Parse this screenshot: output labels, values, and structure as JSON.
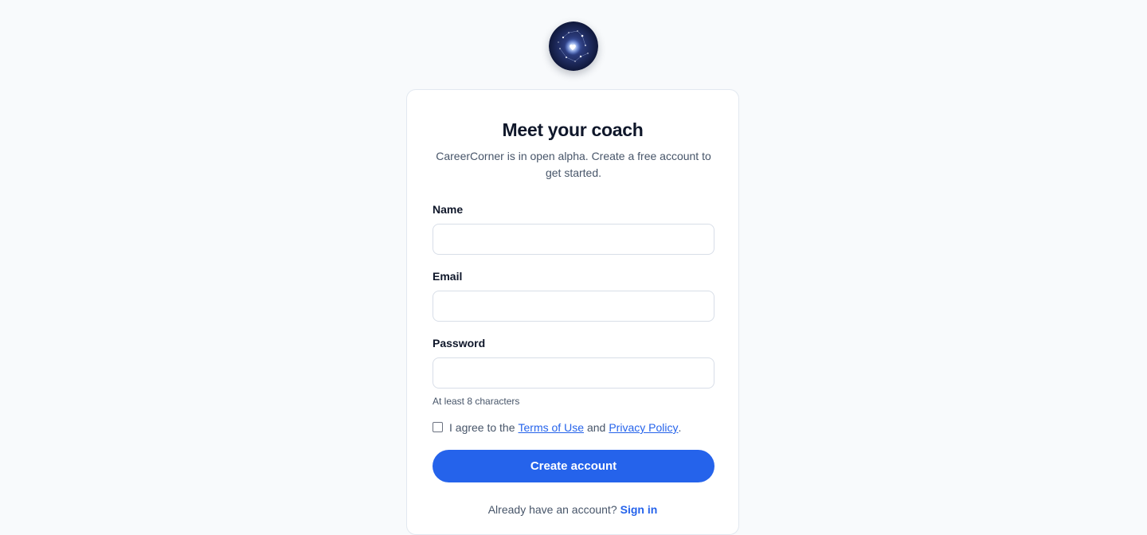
{
  "logo": {
    "icon": "starry-sky-logo"
  },
  "card": {
    "title": "Meet your coach",
    "subtitle": "CareerCorner is in open alpha. Create a free account to get started."
  },
  "form": {
    "name_label": "Name",
    "name_value": "",
    "email_label": "Email",
    "email_value": "",
    "password_label": "Password",
    "password_value": "",
    "password_hint": "At least 8 characters",
    "agree_prefix": "I agree to the",
    "terms_link": "Terms of Use",
    "agree_and": "and",
    "privacy_link": "Privacy Policy",
    "agree_suffix": ".",
    "agree_checked": false,
    "submit_label": "Create account"
  },
  "footer": {
    "prompt": "Already have an account?",
    "signin_link": "Sign in"
  },
  "colors": {
    "accent": "#2563eb",
    "background": "#f8fafc",
    "card": "#ffffff",
    "text": "#0f172a",
    "muted": "#475569"
  }
}
